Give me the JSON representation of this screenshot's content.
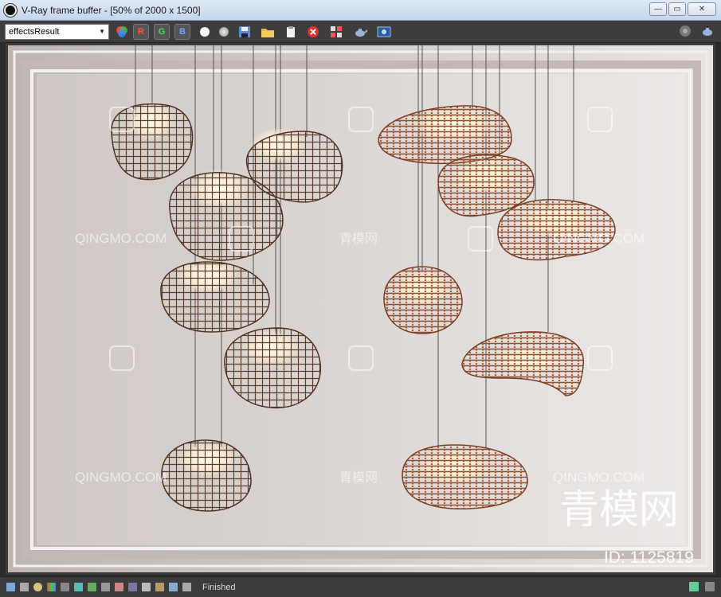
{
  "window": {
    "title": "V-Ray frame buffer - [50% of 2000 x 1500]",
    "minimize": "—",
    "maximize": "▭",
    "close": "✕"
  },
  "toolbar": {
    "channel": "effectsResult",
    "r_label": "R",
    "g_label": "G",
    "b_label": "B",
    "icons": [
      "color-wheel-icon",
      "white-dot-icon",
      "grey-dot-icon",
      "save-icon",
      "open-folder-icon",
      "clear-icon",
      "stop-render-icon",
      "region-render-icon",
      "teapot-icon",
      "lens-effects-icon",
      "settings-icon",
      "teapot-render-icon"
    ]
  },
  "watermarks": {
    "site": "QINGMO.COM",
    "site_cn": "青模网",
    "brand_big": "青模网",
    "id": "ID: 1125819"
  },
  "status": {
    "text": "Finished"
  }
}
